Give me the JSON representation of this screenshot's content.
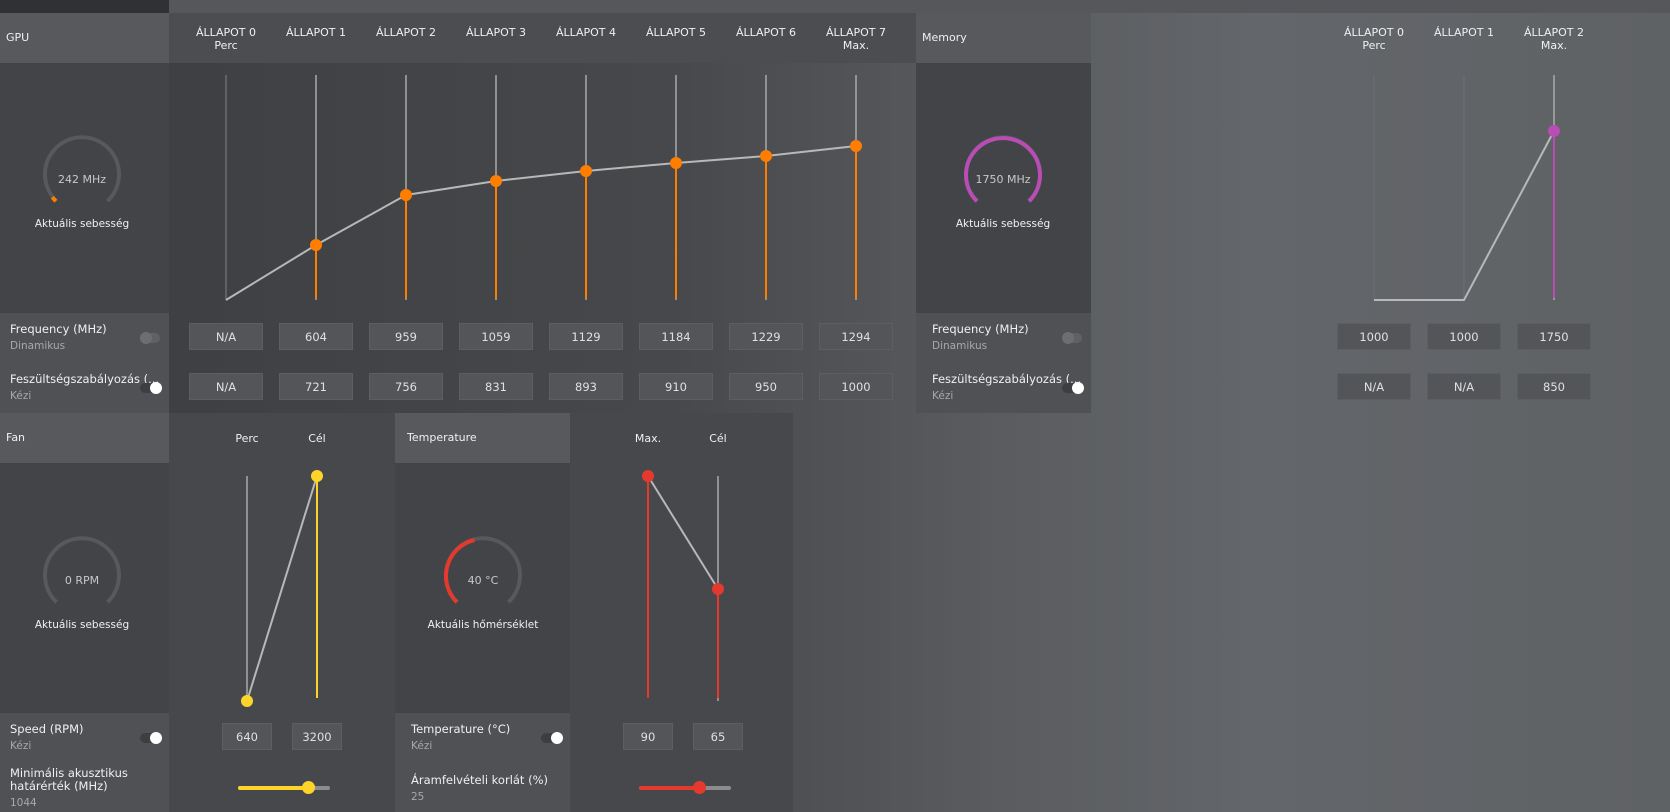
{
  "gpu": {
    "title": "GPU",
    "states": [
      {
        "label": "ÁLLAPOT 0",
        "sub": "Perc"
      },
      {
        "label": "ÁLLAPOT 1",
        "sub": ""
      },
      {
        "label": "ÁLLAPOT 2",
        "sub": ""
      },
      {
        "label": "ÁLLAPOT 3",
        "sub": ""
      },
      {
        "label": "ÁLLAPOT 4",
        "sub": ""
      },
      {
        "label": "ÁLLAPOT 5",
        "sub": ""
      },
      {
        "label": "ÁLLAPOT 6",
        "sub": ""
      },
      {
        "label": "ÁLLAPOT 7",
        "sub": "Max."
      }
    ],
    "gauge_value": "242 MHz",
    "gauge_caption": "Aktuális sebesség",
    "gauge_level": 0.03,
    "frequency_label": "Frequency (MHz)",
    "frequency_mode": "Dinamikus",
    "frequency_values": [
      "N/A",
      "604",
      "959",
      "1059",
      "1129",
      "1184",
      "1229",
      "1294"
    ],
    "voltage_label": "Feszültségszabályozás (...",
    "voltage_mode": "Kézi",
    "voltage_values": [
      "N/A",
      "721",
      "756",
      "831",
      "893",
      "910",
      "950",
      "1000"
    ],
    "accent": "#ff7e00"
  },
  "memory": {
    "title": "Memory",
    "states": [
      {
        "label": "ÁLLAPOT 0",
        "sub": "Perc"
      },
      {
        "label": "ÁLLAPOT 1",
        "sub": ""
      },
      {
        "label": "ÁLLAPOT 2",
        "sub": "Max."
      }
    ],
    "gauge_value": "1750 MHz",
    "gauge_caption": "Aktuális sebesség",
    "gauge_level": 1.0,
    "frequency_label": "Frequency (MHz)",
    "frequency_mode": "Dinamikus",
    "frequency_values": [
      "1000",
      "1000",
      "1750"
    ],
    "voltage_label": "Feszültségszabályozás (...",
    "voltage_mode": "Kézi",
    "voltage_values": [
      "N/A",
      "N/A",
      "850"
    ],
    "accent": "#b94db5"
  },
  "fan": {
    "title": "Fan",
    "cols": [
      "Perc",
      "Cél"
    ],
    "gauge_value": "0 RPM",
    "gauge_caption": "Aktuális sebesség",
    "gauge_level": 0,
    "speed_label": "Speed (RPM)",
    "speed_mode": "Kézi",
    "speed_values": [
      "640",
      "3200"
    ],
    "min_acoustic_label": "Minimális akusztikus határérték (MHz)",
    "min_acoustic_value": "1044",
    "min_acoustic_level": 0.76,
    "accent": "#ffd42a"
  },
  "temperature": {
    "title": "Temperature",
    "cols": [
      "Max.",
      "Cél"
    ],
    "gauge_value": "40 °C",
    "gauge_caption": "Aktuális hőmérséklet",
    "gauge_level": 0.45,
    "temp_label": "Temperature (°C)",
    "temp_mode": "Kézi",
    "temp_values": [
      "90",
      "65"
    ],
    "power_label": "Áramfelvételi korlát (%)",
    "power_value": "25",
    "power_level": 0.65,
    "accent": "#e5392e"
  }
}
